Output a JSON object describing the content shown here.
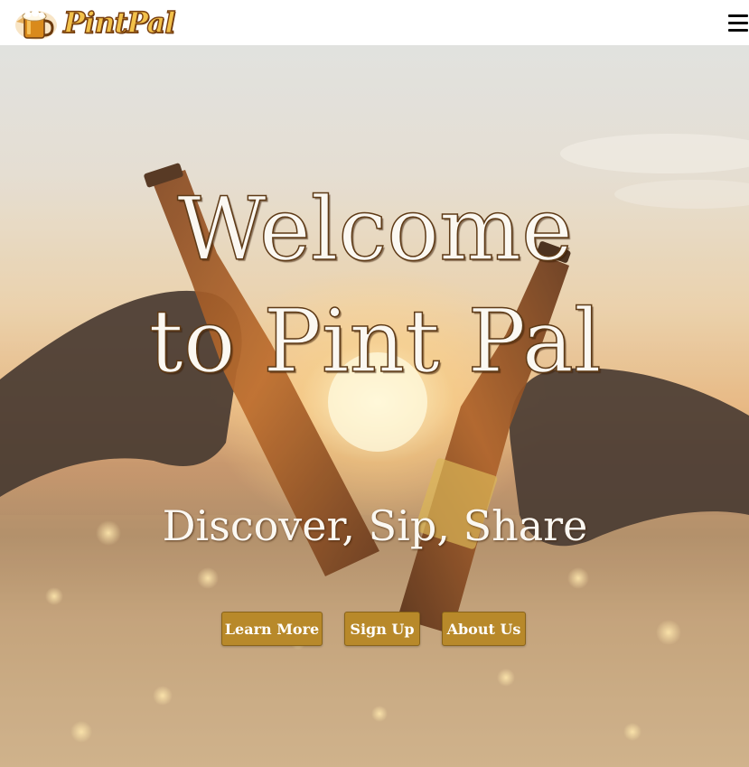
{
  "header": {
    "brand_name": "PintPal",
    "logo_icon": "beer-mug-icon",
    "menu_icon": "hamburger-menu-icon"
  },
  "hero": {
    "headline": "Welcome to Pint Pal",
    "tagline": "Discover, Sip, Share",
    "background_image": "two-beer-bottles-toasting-at-sunset"
  },
  "actions": {
    "learn_more": "Learn More",
    "sign_up": "Sign Up",
    "about_us": "About Us"
  },
  "colors": {
    "button_bg": "#b8892a",
    "brand_gold": "#f2c14a",
    "text_light": "#fbf8f2"
  }
}
